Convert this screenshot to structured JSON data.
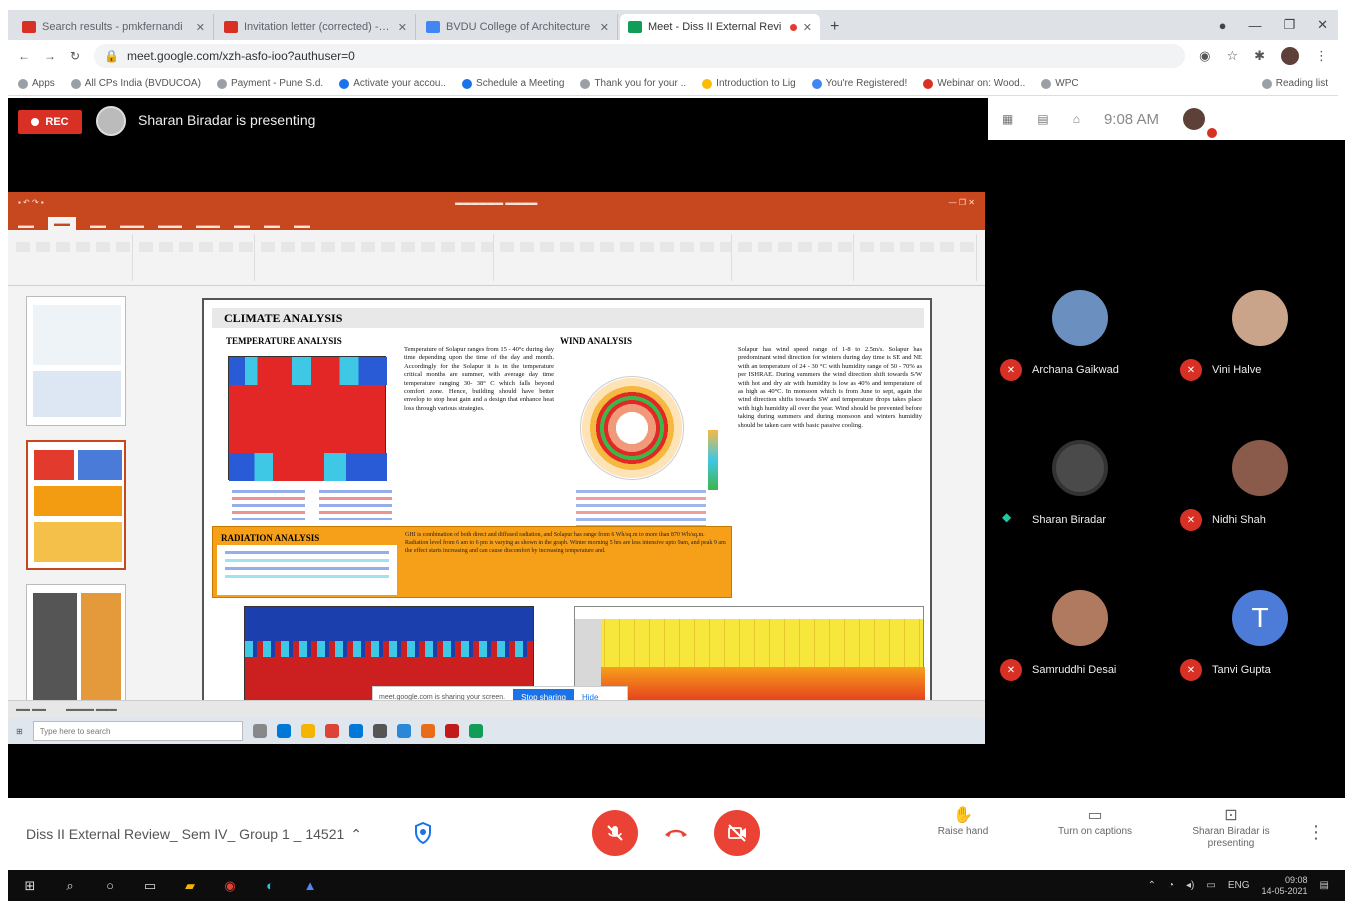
{
  "browser": {
    "tabs": [
      {
        "title": "Search results - pmkfernandi",
        "color": "#d93025"
      },
      {
        "title": "Invitation letter (corrected) - se",
        "color": "#d93025"
      },
      {
        "title": "BVDU College of Architecture",
        "color": "#4285f4"
      },
      {
        "title": "Meet - Diss II External Revi",
        "color": "#0f9d58",
        "active": true
      }
    ],
    "url": "meet.google.com/xzh-asfo-ioo?authuser=0",
    "bookmarks": [
      "Apps",
      "All CPs India (BVDUCOA)",
      "Payment - Pune S.d.",
      "Activate your accou..",
      "Schedule a Meeting",
      "Thank you for your ..",
      "Introduction to Lig",
      "You're Registered!",
      "Webinar on: Wood..",
      "WPC",
      "Reading list"
    ]
  },
  "meet": {
    "rec_label": "REC",
    "presenting_text": "Sharan Biradar is presenting",
    "time": "9:08 AM",
    "meeting_title": "Diss II External Review_ Sem IV_ Group 1 _ 14521",
    "participants": [
      {
        "name": "Archana Gaikwad",
        "muted": true
      },
      {
        "name": "Vini Halve",
        "muted": true
      },
      {
        "name": "Sharan Biradar",
        "muted": false
      },
      {
        "name": "Nidhi Shah",
        "muted": true
      },
      {
        "name": "Samruddhi Desai",
        "muted": true
      },
      {
        "name": "Tanvi Gupta",
        "muted": true,
        "initial": "T"
      }
    ],
    "controls": {
      "raise_hand": "Raise hand",
      "captions": "Turn on captions",
      "presenting": "Sharan Biradar is presenting"
    }
  },
  "slide": {
    "title": "CLIMATE ANALYSIS",
    "temperature_heading": "TEMPERATURE ANALYSIS",
    "wind_heading": "WIND ANALYSIS",
    "radiation_heading": "RADIATION ANALYSIS",
    "temperature_text": "Temperature of Solapur ranges from 15 - 40°c during day time depending upon the time of the day and month. Accordingly for the Solapur it is in the temperature critical months are summer, with average day time temperature ranging 30- 38° C which falls beyond comfort zone. Hence, building should have better envelop to stop heat gain and a design that enhance heat loss through various strategies.",
    "wind_text": "Solapur has wind speed range of 1-8 to 2.5m/s. Solapur has predominant wind direction for winters during day time is SE and NE with an temperature of 24 - 30 °C with humidity range of 50 - 70% as per ISHRAE. During summers the wind direction shift towards S/W with hot and dry air with humidity is low as 40% and temperature of as high as 40°C. In monsoon which is from June to sept, again the wind direction shifts towards SW and temperature drops takes place with high humidity all over the year. Wind should be prevented before taking during summers and during monsoon and winters humidity should be taken care with basic passive cooling.",
    "radiation_text": "GHI is combination of both direct and diffused radiation, and Solapur has range from 6 Wh/sq.m to more than 870 Wh/sq.m. Radiation level from 6 am to 6 pm is varying as shown in the graph. Winter morning 5 hrs are less intensive upto 9am, and peak 9 am the effect starts increasing and can cause discomfort by increasing temperature and.",
    "share_notice": "meet.google.com is sharing your screen.",
    "stop_sharing": "Stop sharing",
    "hide": "Hide"
  },
  "windows": {
    "search_placeholder": "Type here to search",
    "lang": "ENG",
    "clock_time": "09:08",
    "clock_date": "14-05-2021"
  }
}
